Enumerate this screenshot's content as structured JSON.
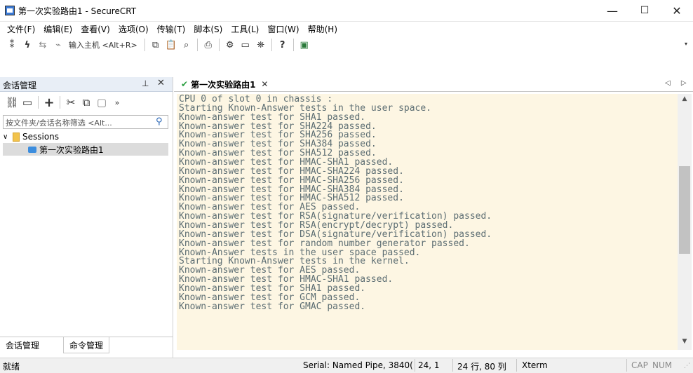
{
  "window": {
    "title": "第一次实验路由1 - SecureCRT",
    "minimize": "—",
    "maximize": "☐",
    "close": "✕"
  },
  "menu": [
    "文件(F)",
    "编辑(E)",
    "查看(V)",
    "选项(O)",
    "传输(T)",
    "脚本(S)",
    "工具(L)",
    "窗口(W)",
    "帮助(H)"
  ],
  "toolbar": {
    "quick_connect": "输入主机 <Alt+R>",
    "icons": [
      "connect-icon",
      "quick-connect-icon",
      "reconnect-icon",
      "disconnect-icon",
      "copy-icon",
      "paste-icon",
      "find-icon",
      "print-icon",
      "settings-icon",
      "keymap-icon",
      "sftp-icon",
      "help-icon",
      "screenshot-icon"
    ]
  },
  "session_panel": {
    "title": "会话管理",
    "pin": "ᚁ",
    "close": "✕",
    "filter_placeholder": "按文件夹/会话名称筛选 <Alt...",
    "tree": {
      "folder": "Sessions",
      "session": "第一次实验路由1"
    },
    "tabs": [
      "会话管理",
      "命令管理"
    ]
  },
  "terminal": {
    "tab_label": "第一次实验路由1",
    "tab_close": "✕",
    "nav": "◁ ▷",
    "lines": [
      "CPU 0 of slot 0 in chassis :",
      "Starting Known-Answer tests in the user space.",
      "Known-answer test for SHA1 passed.",
      "Known-answer test for SHA224 passed.",
      "Known-answer test for SHA256 passed.",
      "Known-answer test for SHA384 passed.",
      "Known-answer test for SHA512 passed.",
      "Known-answer test for HMAC-SHA1 passed.",
      "Known-answer test for HMAC-SHA224 passed.",
      "Known-answer test for HMAC-SHA256 passed.",
      "Known-answer test for HMAC-SHA384 passed.",
      "Known-answer test for HMAC-SHA512 passed.",
      "Known-answer test for AES passed.",
      "Known-answer test for RSA(signature/verification) passed.",
      "Known-answer test for RSA(encrypt/decrypt) passed.",
      "Known-answer test for DSA(signature/verification) passed.",
      "Known-answer test for random number generator passed.",
      "Known-Answer tests in the user space passed.",
      "Starting Known-Answer tests in the kernel.",
      "Known-answer test for AES passed.",
      "Known-answer test for HMAC-SHA1 passed.",
      "Known-answer test for SHA1 passed.",
      "Known-answer test for GCM passed.",
      "Known-answer test for GMAC passed."
    ],
    "scroll_position": 0.42,
    "scroll_visible_fraction": 0.38,
    "colors": {
      "background": "#fdf6e3",
      "text": "#5d6e73"
    }
  },
  "statusbar": {
    "ready": "就绪",
    "serial": "Serial: Named Pipe, 3840(",
    "cursor": "24,  1",
    "size": "24 行, 80 列",
    "emulation": "Xterm",
    "cap": "CAP",
    "num": "NUM"
  }
}
